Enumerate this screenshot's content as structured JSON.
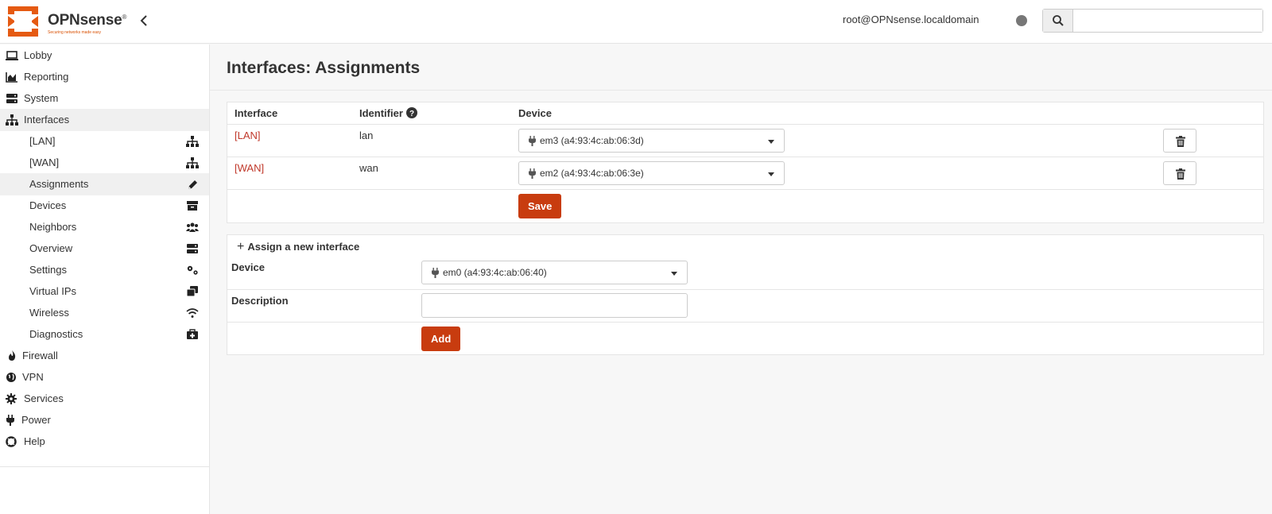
{
  "brand": {
    "name": "OPNsense",
    "registered": "®",
    "tagline": "Securing networks made easy",
    "accent": "#d94f00"
  },
  "header": {
    "user": "root@OPNsense.localdomain",
    "search_placeholder": ""
  },
  "sidebar": {
    "items": [
      {
        "label": "Lobby",
        "icon": "laptop-icon"
      },
      {
        "label": "Reporting",
        "icon": "area-chart-icon"
      },
      {
        "label": "System",
        "icon": "server-icon"
      },
      {
        "label": "Interfaces",
        "icon": "sitemap-icon"
      },
      {
        "label": "Firewall",
        "icon": "fire-icon"
      },
      {
        "label": "VPN",
        "icon": "globe-icon"
      },
      {
        "label": "Services",
        "icon": "cog-icon"
      },
      {
        "label": "Power",
        "icon": "plug-icon"
      },
      {
        "label": "Help",
        "icon": "life-ring-icon"
      }
    ],
    "interfaces_sub": [
      {
        "label": "[LAN]",
        "icon": "sitemap-icon"
      },
      {
        "label": "[WAN]",
        "icon": "sitemap-icon"
      },
      {
        "label": "Assignments",
        "icon": "pencil-icon"
      },
      {
        "label": "Devices",
        "icon": "archive-icon"
      },
      {
        "label": "Neighbors",
        "icon": "users-icon"
      },
      {
        "label": "Overview",
        "icon": "server-icon"
      },
      {
        "label": "Settings",
        "icon": "cogs-icon"
      },
      {
        "label": "Virtual IPs",
        "icon": "clone-icon"
      },
      {
        "label": "Wireless",
        "icon": "wifi-icon"
      },
      {
        "label": "Diagnostics",
        "icon": "medkit-icon"
      }
    ]
  },
  "page": {
    "title": "Interfaces: Assignments"
  },
  "assignments": {
    "headers": {
      "interface": "Interface",
      "identifier": "Identifier",
      "device": "Device"
    },
    "rows": [
      {
        "interface": "[LAN]",
        "identifier": "lan",
        "device": "em3 (a4:93:4c:ab:06:3d)"
      },
      {
        "interface": "[WAN]",
        "identifier": "wan",
        "device": "em2 (a4:93:4c:ab:06:3e)"
      }
    ],
    "save_label": "Save"
  },
  "new_interface": {
    "heading": "Assign a new interface",
    "device_label": "Device",
    "device_value": "em0 (a4:93:4c:ab:06:40)",
    "description_label": "Description",
    "description_value": "",
    "add_label": "Add"
  }
}
